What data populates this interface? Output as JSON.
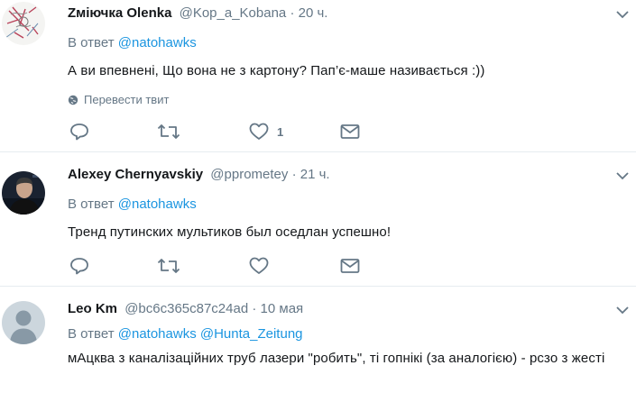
{
  "reply_prefix": "В ответ",
  "tweets": [
    {
      "name": "Zміючка Olenka",
      "handle": "@Kop_a_Kobana",
      "separator": "·",
      "time": "20 ч.",
      "mentions": [
        "@natohawks"
      ],
      "text": "А ви впевнені, Що вона не з картону? Пап’є-маше називається :))",
      "translate_label": "Перевести твит",
      "like_count": "1",
      "avatar": "sketch-drawing"
    },
    {
      "name": "Alexey Chernyavskiy",
      "handle": "@pprometey",
      "separator": "·",
      "time": "21 ч.",
      "mentions": [
        "@natohawks"
      ],
      "text": "Тренд путинских мультиков был оседлан успешно!",
      "avatar": "photo"
    },
    {
      "name": "Leo Km",
      "handle": "@bc6c365c87c24ad",
      "separator": "·",
      "time": "10 мая",
      "mentions": [
        "@natohawks",
        "@Hunta_Zeitung"
      ],
      "text": "мАцква з каналізаційних труб лазери \"робить\", ті гопнікі (за аналогією) - рсзо з жесті",
      "avatar": "default-gray"
    }
  ],
  "colors": {
    "link": "#1b95e0",
    "muted": "#657786",
    "text": "#14171a",
    "divider": "#e6ecf0"
  }
}
